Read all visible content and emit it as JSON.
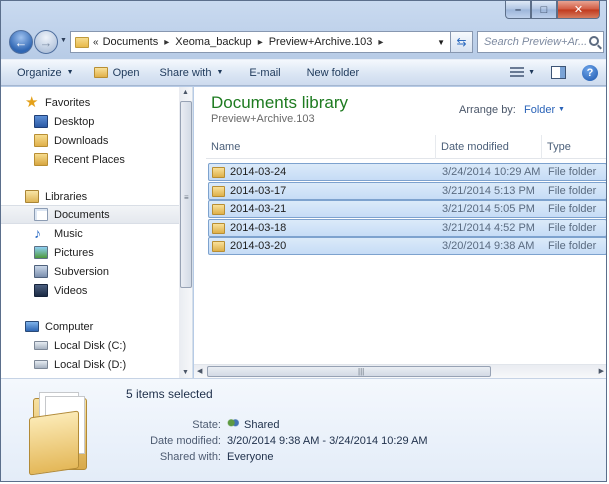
{
  "window": {
    "caption": {
      "minimize": "–",
      "maximize": "□",
      "close": "✕"
    }
  },
  "address": {
    "overflow": "«",
    "segments": [
      "Documents",
      "Xeoma_backup",
      "Preview+Archive.103"
    ],
    "separator": "▸",
    "search_placeholder": "Search Preview+Ar..."
  },
  "toolbar": {
    "organize": "Organize",
    "open": "Open",
    "share_with": "Share with",
    "email": "E-mail",
    "new_folder": "New folder",
    "help": "?"
  },
  "nav": {
    "favorites": "Favorites",
    "desktop": "Desktop",
    "downloads": "Downloads",
    "recent_places": "Recent Places",
    "libraries": "Libraries",
    "documents": "Documents",
    "music": "Music",
    "pictures": "Pictures",
    "subversion": "Subversion",
    "videos": "Videos",
    "computer": "Computer",
    "local_c": "Local Disk (C:)",
    "local_d": "Local Disk (D:)"
  },
  "library": {
    "title": "Documents library",
    "subtitle": "Preview+Archive.103",
    "arrange_label": "Arrange by:",
    "arrange_value": "Folder"
  },
  "columns": {
    "name": "Name",
    "date": "Date modified",
    "type": "Type"
  },
  "rows": [
    {
      "name": "2014-03-24",
      "date": "3/24/2014 10:29 AM",
      "type": "File folder"
    },
    {
      "name": "2014-03-17",
      "date": "3/21/2014 5:13 PM",
      "type": "File folder"
    },
    {
      "name": "2014-03-21",
      "date": "3/21/2014 5:05 PM",
      "type": "File folder"
    },
    {
      "name": "2014-03-18",
      "date": "3/21/2014 4:52 PM",
      "type": "File folder"
    },
    {
      "name": "2014-03-20",
      "date": "3/20/2014 9:38 AM",
      "type": "File folder"
    }
  ],
  "details": {
    "selected": "5 items selected",
    "state_label": "State:",
    "state_value": "Shared",
    "date_label": "Date modified:",
    "date_value": "3/20/2014 9:38 AM - 3/24/2014 10:29 AM",
    "shared_label": "Shared with:",
    "shared_value": "Everyone"
  },
  "colors": {
    "library_title": "#1e7b20",
    "selection_fill": "#c6dcf6",
    "selection_border": "#7da2ce",
    "link_blue": "#2a63b8"
  }
}
